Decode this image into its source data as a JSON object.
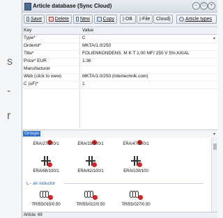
{
  "background_fragments": [
    "s",
    "-",
    "r"
  ],
  "window": {
    "title": "Article database (Sync Cloud)",
    "controls": [
      "−",
      "□",
      "×"
    ]
  },
  "toolbar": {
    "save_label": "Save",
    "delete_label": "Delete",
    "new_label": "New",
    "copy_label": "Copy",
    "db_label": "|-DB",
    "file_label": "|-File",
    "cloud_label": "Cloud)",
    "article_types_label": "Article types"
  },
  "grid": {
    "headers": {
      "key": "Key",
      "value": "Value"
    },
    "rows": [
      {
        "key": "Type*",
        "value": "C",
        "dropdown": true
      },
      {
        "key": "OrderId*",
        "value": "MKTA/1.0/250"
      },
      {
        "key": "Title*",
        "value": "FOLIENKONDENS. M K T 1.00 MF/ 250 V 5% AXIAL"
      },
      {
        "key": "Price* EUR",
        "value": "1.36"
      },
      {
        "key": "Manufacturer",
        "value": ""
      },
      {
        "key": "Web (click to view)",
        "value": "MKTA/1.0/250 (intertechnik.com)"
      },
      {
        "key": "C (uF)*",
        "value": "1"
      }
    ]
  },
  "group_selector": {
    "selected": "Groups"
  },
  "articles": {
    "row1": [
      "ERA/27/100/1",
      "ERA/33/100/1",
      "ERA/47/100/1"
    ],
    "row2": [
      "ERA/68/100/1",
      "ERA/82/100/1",
      "ERA/100/100"
    ],
    "section_title": "L - air inductor",
    "row3": [
      "TRI55/015/0.50",
      "TRI55/022/0.50",
      "TRI55/027/0.50"
    ]
  },
  "icons": {
    "capacitor": "capacitor-icon",
    "inductor": "air-inductor-icon"
  },
  "status": {
    "text": "Article: 69"
  },
  "colors": {
    "accent": "#2f6fce",
    "marker": "#d52424",
    "section": "#2a5aa8"
  }
}
